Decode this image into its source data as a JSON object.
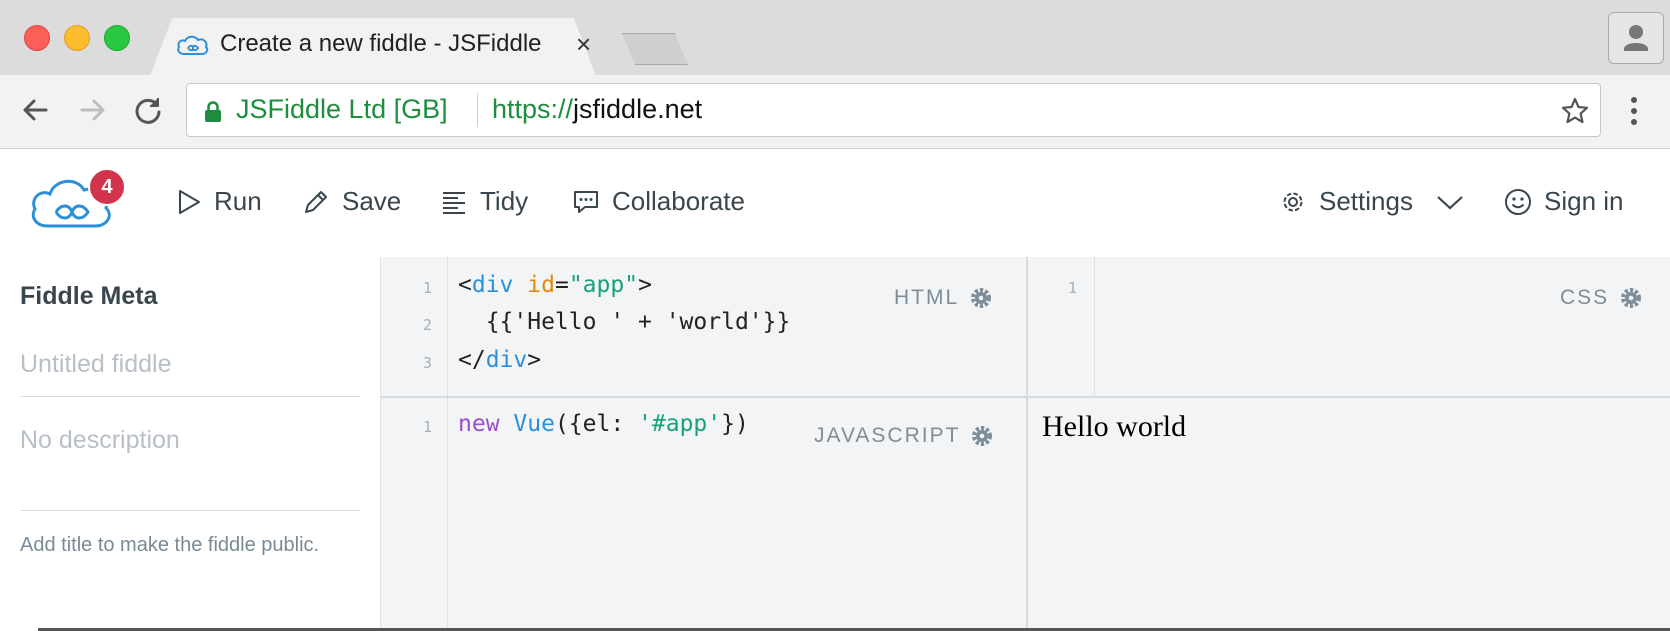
{
  "browser": {
    "tab_title": "Create a new fiddle - JSFiddle",
    "tab_close": "×",
    "ev_label": "JSFiddle Ltd [GB]",
    "url_scheme": "https://",
    "url_host": "jsfiddle.net"
  },
  "app": {
    "notification_count": "4",
    "actions": {
      "run": "Run",
      "save": "Save",
      "tidy": "Tidy",
      "collaborate": "Collaborate",
      "settings": "Settings",
      "sign_in": "Sign in"
    }
  },
  "sidebar": {
    "title": "Fiddle Meta",
    "title_placeholder": "Untitled fiddle",
    "description_placeholder": "No description",
    "hint": "Add title to make the fiddle public."
  },
  "editors": {
    "html": {
      "label": "HTML",
      "line_numbers": [
        "1",
        "2",
        "3"
      ],
      "lines": {
        "l1": {
          "lt": "<",
          "tag": "div",
          "sp": " ",
          "attr": "id",
          "eq": "=",
          "val": "\"app\"",
          "gt": ">"
        },
        "l2": "  {{'Hello ' + 'world'}}",
        "l3": {
          "lt": "</",
          "tag": "div",
          "gt": ">"
        }
      }
    },
    "css": {
      "label": "CSS",
      "line_numbers": [
        "1"
      ]
    },
    "javascript": {
      "label": "JAVASCRIPT",
      "line_numbers": [
        "1"
      ],
      "line1": {
        "kw": "new",
        "sp": " ",
        "cls": "Vue",
        "open": "({el: ",
        "str": "'#app'",
        "close": "})"
      }
    },
    "result": {
      "text": "Hello world"
    }
  },
  "colors": {
    "accent": "#2b90d9",
    "badge": "#d1344c",
    "secure_green": "#1e8e3e"
  }
}
